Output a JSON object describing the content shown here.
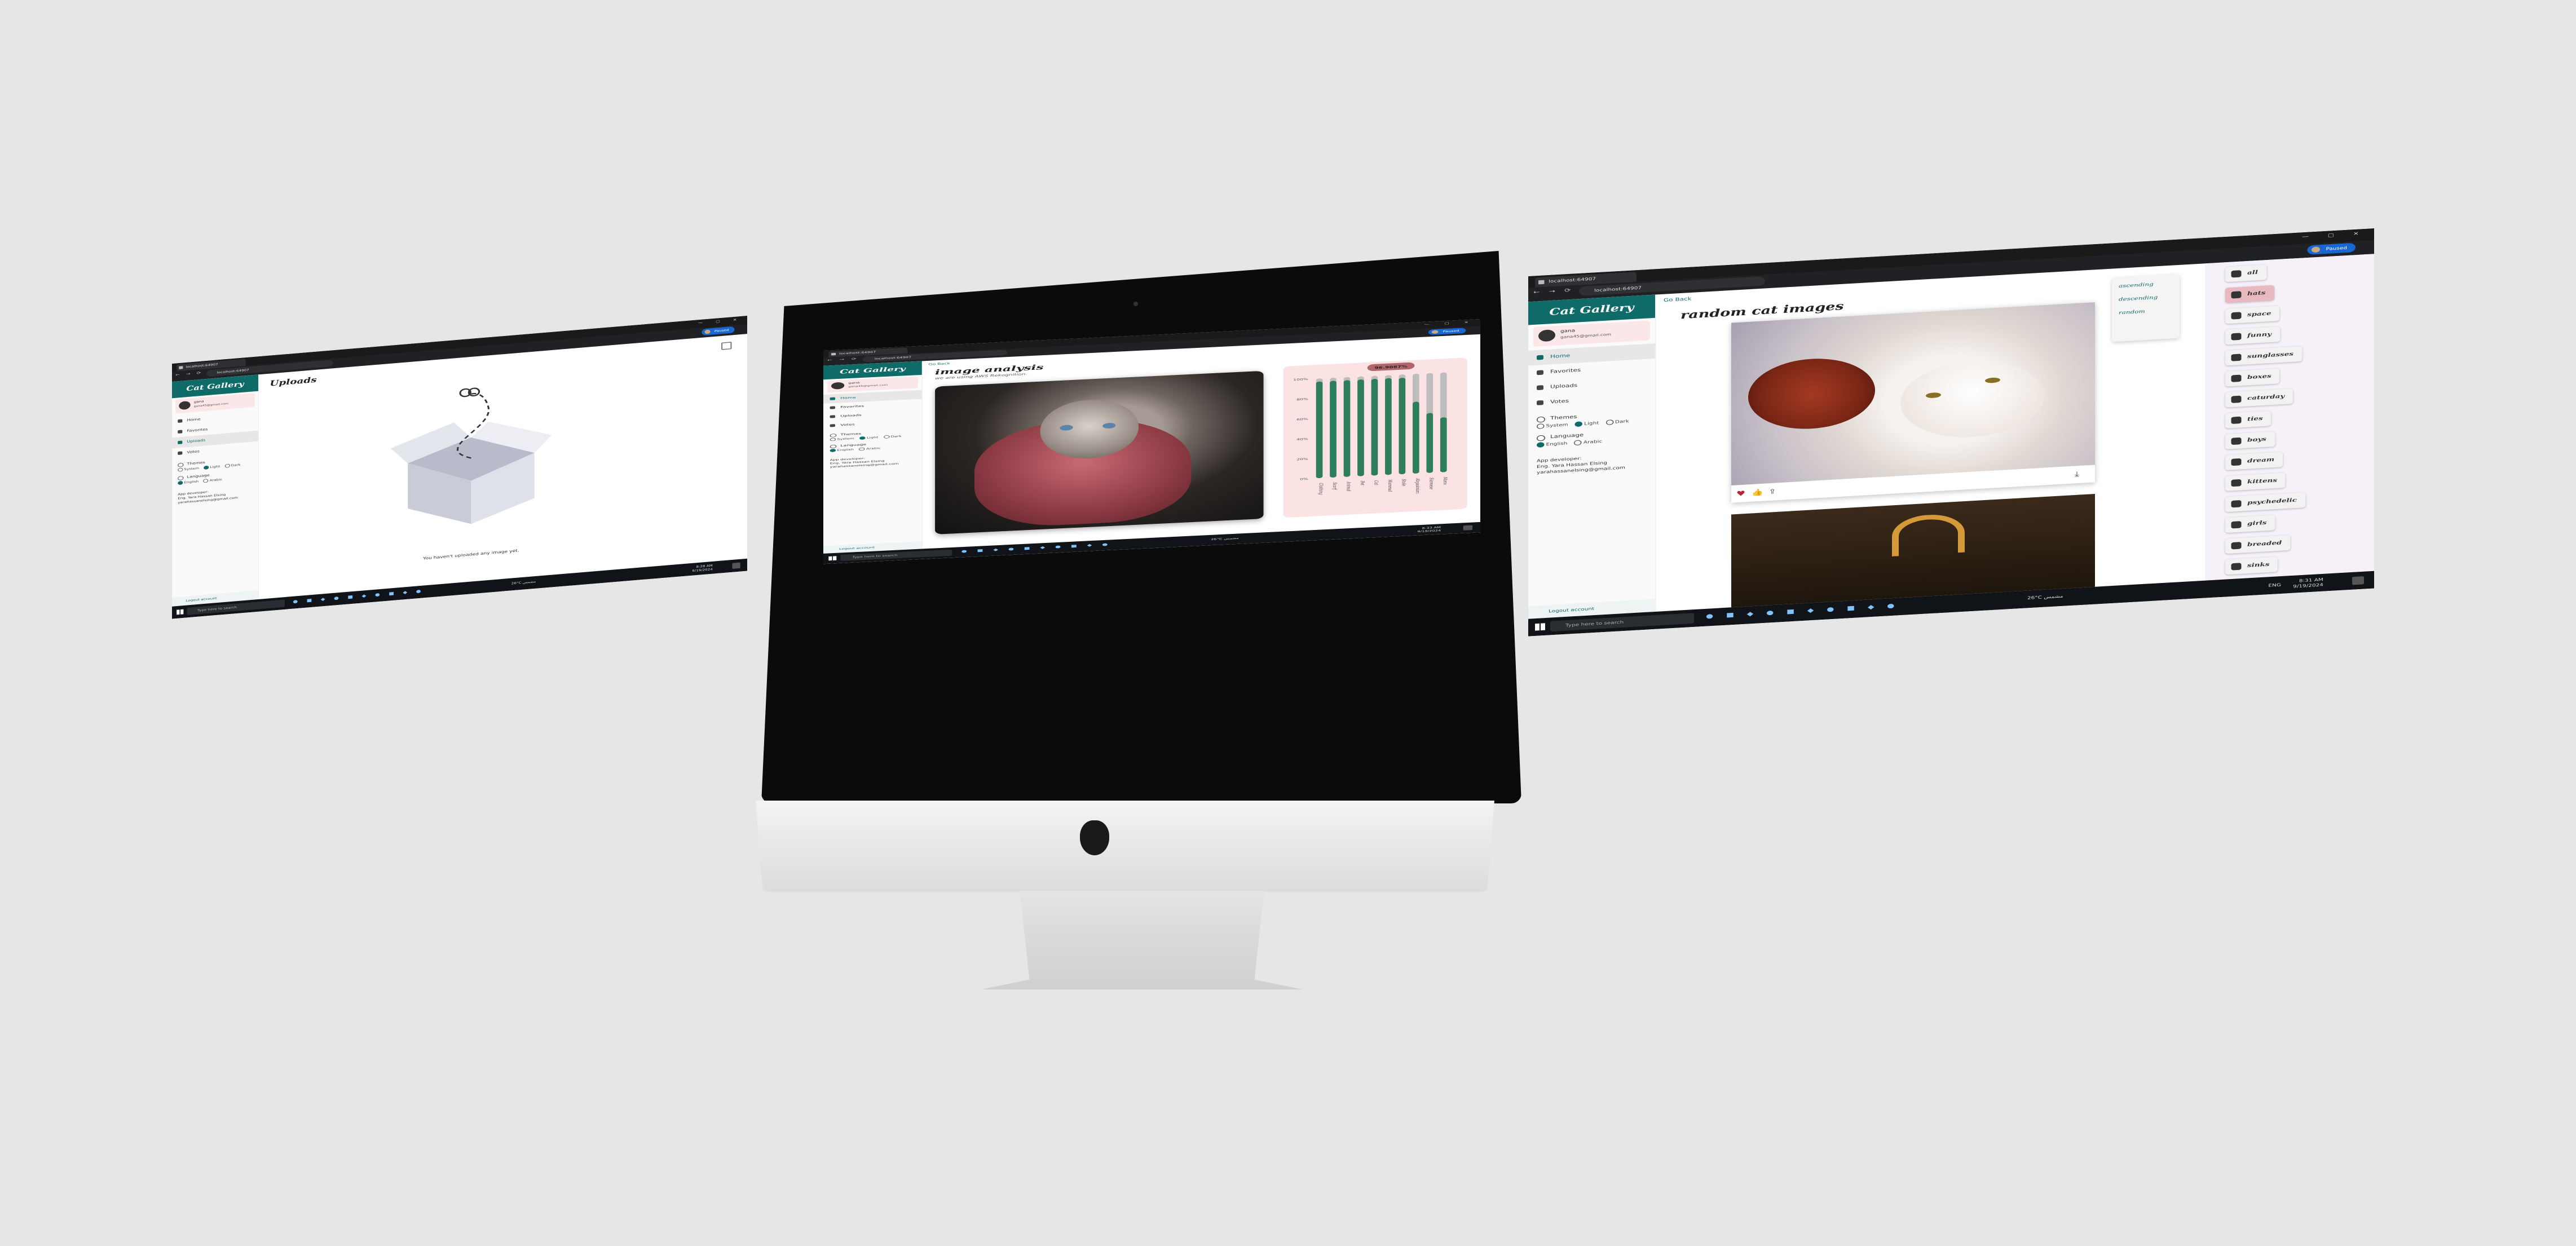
{
  "common": {
    "tab_title": "localhost:64907",
    "url": "localhost:64907",
    "paused_label": "Paused",
    "brand": "Cat Gallery",
    "user_name": "gana",
    "user_email": "gana45@gmail.com",
    "nav": {
      "home": "Home",
      "favorites": "Favorites",
      "uploads": "Uploads",
      "votes": "Votes"
    },
    "themes_label": "Themes",
    "theme_options": [
      "System",
      "Light",
      "Dark"
    ],
    "language_label": "Language",
    "language_options": [
      "English",
      "Arabic"
    ],
    "dev_line1": "App developer:",
    "dev_line2": "Eng. Yara Hassan Elsing",
    "dev_line3": "yarahassanelsing@gmail.com",
    "logout": "Logout account",
    "back": "Go Back",
    "taskbar_search": "Type here to search",
    "weather": "26°C مشمس",
    "lang_indicator": "ENG",
    "time_left": "8:28 AM",
    "time_mid": "8:33 AM",
    "time_right": "8:31 AM",
    "date": "9/19/2024"
  },
  "left_screen": {
    "title": "Uploads",
    "empty_message": "You haven't uploaded any image yet."
  },
  "center_screen": {
    "title": "image analysis",
    "subtitle": "we are using AWS Rekognition.",
    "badge": "96.9087%"
  },
  "chart_data": {
    "type": "bar",
    "title": "",
    "categories": [
      "Clothing",
      "Scarf",
      "Animal",
      "Pet",
      "Cat",
      "Mammal",
      "Stole",
      "Abyssinian",
      "Siamese",
      "Manx"
    ],
    "values": [
      96.9,
      96.9,
      96.9,
      96.9,
      96.9,
      96.9,
      96.6,
      72,
      60,
      55
    ],
    "ylim": [
      0,
      100
    ],
    "yticks": [
      "0%",
      "20%",
      "40%",
      "60%",
      "80%",
      "100%"
    ],
    "bar_color": "#2e7d5b",
    "track_color": "#bdbdbd"
  },
  "right_screen": {
    "title": "random cat images",
    "sort_options": [
      "ascending",
      "descending",
      "random"
    ],
    "categories": [
      "all",
      "hats",
      "space",
      "funny",
      "sunglasses",
      "boxes",
      "caturday",
      "ties",
      "boys",
      "dream",
      "kittens",
      "psychedelic",
      "girls",
      "breaded",
      "sinks"
    ]
  },
  "colors": {
    "brand": "#0e6b68",
    "accent_pink": "#fbe7e7",
    "badge": "#b0676c"
  }
}
